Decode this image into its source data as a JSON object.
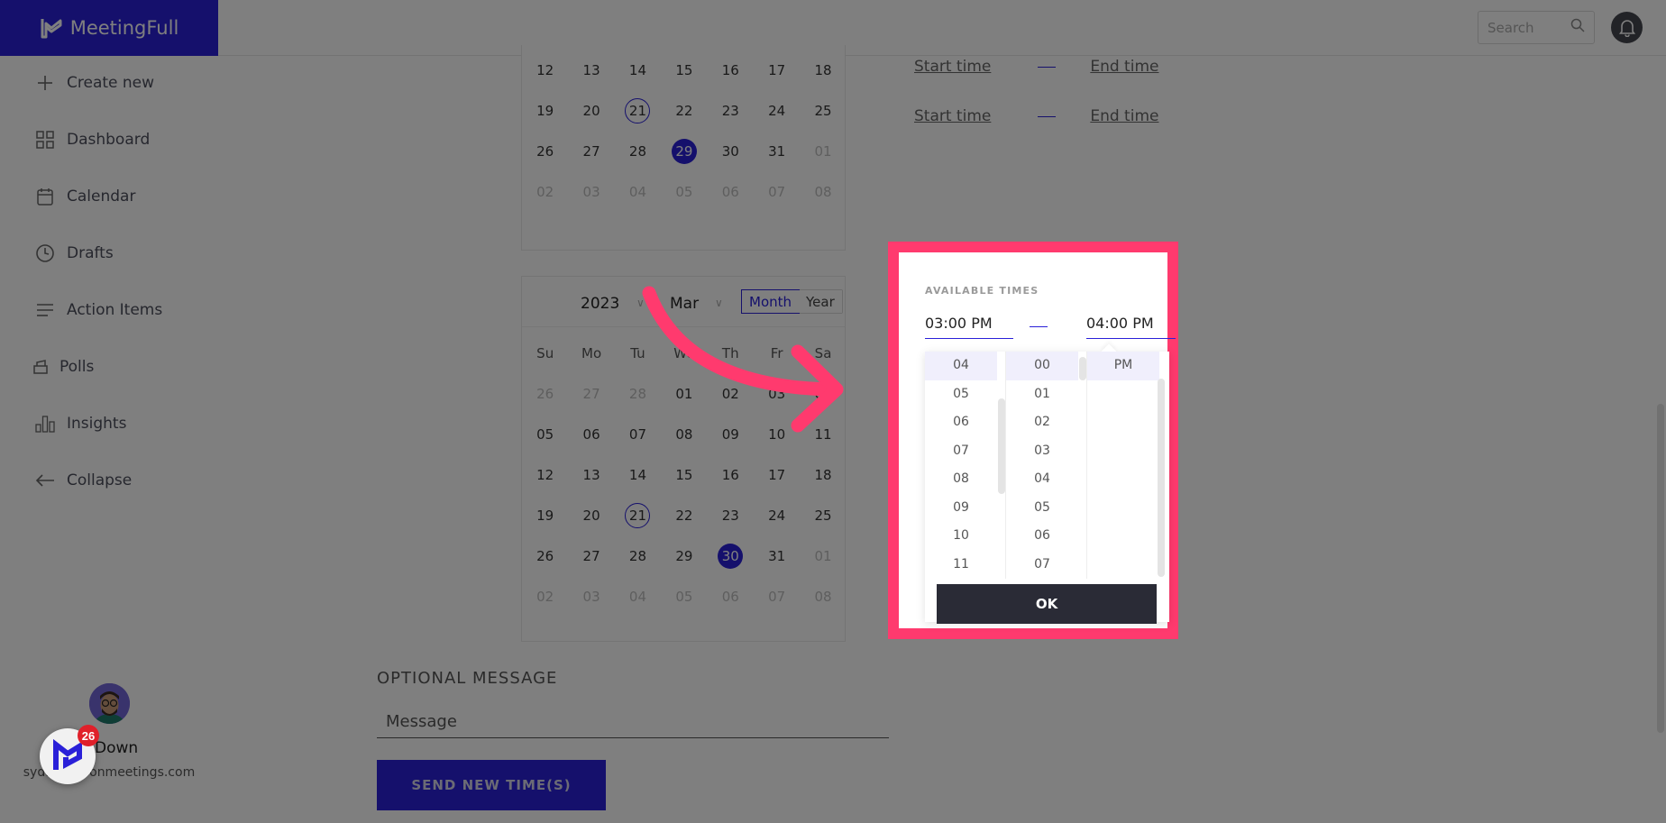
{
  "app": {
    "brand_name": "MeetingFull",
    "accent_color": "#2a20d8",
    "highlight_color": "#ff3a6e"
  },
  "header": {
    "search_placeholder": "Search",
    "icons": [
      "search-icon",
      "bell-icon"
    ]
  },
  "sidebar": {
    "items": [
      {
        "label": "Create new",
        "icon": "plus-icon"
      },
      {
        "label": "Dashboard",
        "icon": "grid-icon"
      },
      {
        "label": "Calendar",
        "icon": "calendar-icon"
      },
      {
        "label": "Drafts",
        "icon": "clock-icon"
      },
      {
        "label": "Action Items",
        "icon": "list-icon"
      },
      {
        "label": "Polls",
        "icon": "ballot-box-icon"
      },
      {
        "label": "Insights",
        "icon": "bar-chart-icon"
      },
      {
        "label": "Collapse",
        "icon": "arrow-left-icon"
      }
    ],
    "user": {
      "name_visible": "d Down",
      "email_visible": "syd.d...moonmeetings.com"
    },
    "fab": {
      "badge_count": "26"
    }
  },
  "calendar_top": {
    "rows": [
      [
        {
          "d": "12"
        },
        {
          "d": "13"
        },
        {
          "d": "14"
        },
        {
          "d": "15"
        },
        {
          "d": "16"
        },
        {
          "d": "17"
        },
        {
          "d": "18"
        }
      ],
      [
        {
          "d": "19"
        },
        {
          "d": "20"
        },
        {
          "d": "21",
          "today": true
        },
        {
          "d": "22"
        },
        {
          "d": "23"
        },
        {
          "d": "24"
        },
        {
          "d": "25"
        }
      ],
      [
        {
          "d": "26"
        },
        {
          "d": "27"
        },
        {
          "d": "28"
        },
        {
          "d": "29",
          "selected": true
        },
        {
          "d": "30"
        },
        {
          "d": "31"
        },
        {
          "d": "01",
          "muted": true
        }
      ],
      [
        {
          "d": "02",
          "muted": true
        },
        {
          "d": "03",
          "muted": true
        },
        {
          "d": "04",
          "muted": true
        },
        {
          "d": "05",
          "muted": true
        },
        {
          "d": "06",
          "muted": true
        },
        {
          "d": "07",
          "muted": true
        },
        {
          "d": "08",
          "muted": true
        }
      ]
    ]
  },
  "calendar_bottom": {
    "year": "2023",
    "month": "Mar",
    "mode_month": "Month",
    "mode_year": "Year",
    "weekdays": [
      "Su",
      "Mo",
      "Tu",
      "We",
      "Th",
      "Fr",
      "Sa"
    ],
    "rows": [
      [
        {
          "d": "26",
          "muted": true
        },
        {
          "d": "27",
          "muted": true
        },
        {
          "d": "28",
          "muted": true
        },
        {
          "d": "01"
        },
        {
          "d": "02"
        },
        {
          "d": "03"
        },
        {
          "d": "04"
        }
      ],
      [
        {
          "d": "05"
        },
        {
          "d": "06"
        },
        {
          "d": "07"
        },
        {
          "d": "08"
        },
        {
          "d": "09"
        },
        {
          "d": "10"
        },
        {
          "d": "11"
        }
      ],
      [
        {
          "d": "12"
        },
        {
          "d": "13"
        },
        {
          "d": "14"
        },
        {
          "d": "15"
        },
        {
          "d": "16"
        },
        {
          "d": "17"
        },
        {
          "d": "18"
        }
      ],
      [
        {
          "d": "19"
        },
        {
          "d": "20"
        },
        {
          "d": "21",
          "today": true
        },
        {
          "d": "22"
        },
        {
          "d": "23"
        },
        {
          "d": "24"
        },
        {
          "d": "25"
        }
      ],
      [
        {
          "d": "26"
        },
        {
          "d": "27"
        },
        {
          "d": "28"
        },
        {
          "d": "29"
        },
        {
          "d": "30",
          "selected": true
        },
        {
          "d": "31"
        },
        {
          "d": "01",
          "muted": true
        }
      ],
      [
        {
          "d": "02",
          "muted": true
        },
        {
          "d": "03",
          "muted": true
        },
        {
          "d": "04",
          "muted": true
        },
        {
          "d": "05",
          "muted": true
        },
        {
          "d": "06",
          "muted": true
        },
        {
          "d": "07",
          "muted": true
        },
        {
          "d": "08",
          "muted": true
        }
      ]
    ]
  },
  "time_slots": [
    {
      "start": "Start time",
      "end": "End time"
    },
    {
      "start": "Start time",
      "end": "End time"
    }
  ],
  "time_picker": {
    "label": "AVAILABLE TIMES",
    "start_value": "03:00 PM",
    "end_value": "04:00 PM",
    "hours": [
      "04",
      "05",
      "06",
      "07",
      "08",
      "09",
      "10",
      "11"
    ],
    "selected_hour": "04",
    "minutes": [
      "00",
      "01",
      "02",
      "03",
      "04",
      "05",
      "06",
      "07"
    ],
    "selected_minute": "00",
    "periods": [
      "PM"
    ],
    "selected_period": "PM",
    "ok_label": "OK"
  },
  "message": {
    "section_label": "OPTIONAL MESSAGE",
    "placeholder": "Message",
    "value": "",
    "send_label": "SEND NEW TIME(S)"
  }
}
